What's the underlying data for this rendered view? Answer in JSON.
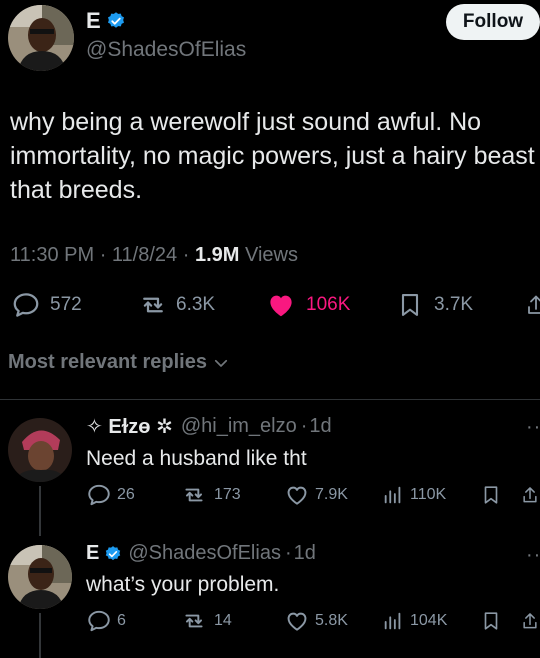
{
  "tweet": {
    "author_name": "E",
    "author_handle": "@ShadesOfElias",
    "follow_label": "Follow",
    "text_lines": [
      "why being a werewolf just sound awful. No",
      "immortality, no magic powers, just a hairy beast",
      "that breeds."
    ],
    "time": "11:30 PM",
    "date": "11/8/24",
    "views_count": "1.9M",
    "views_label": "Views",
    "separator": "·",
    "stats": {
      "replies": "572",
      "reposts": "6.3K",
      "likes": "106K",
      "bookmarks": "3.7K"
    }
  },
  "replies_sort": {
    "label": "Most relevant replies"
  },
  "replies": [
    {
      "name": "✧ Eɫzɵ ✲",
      "handle": "@hi_im_elzo",
      "age": "1d",
      "text": "Need a husband like tht",
      "stats": {
        "replies": "26",
        "reposts": "173",
        "likes": "7.9K",
        "views": "110K"
      }
    },
    {
      "name": "E",
      "handle": "@ShadesOfElias",
      "age": "1d",
      "text": "what’s your problem.",
      "stats": {
        "replies": "6",
        "reposts": "14",
        "likes": "5.8K",
        "views": "104K"
      }
    }
  ],
  "colors": {
    "background": "#000000",
    "text": "#e7e9ea",
    "muted": "#71767b",
    "like_active": "#f91880",
    "verified": "#1d9bf0"
  }
}
